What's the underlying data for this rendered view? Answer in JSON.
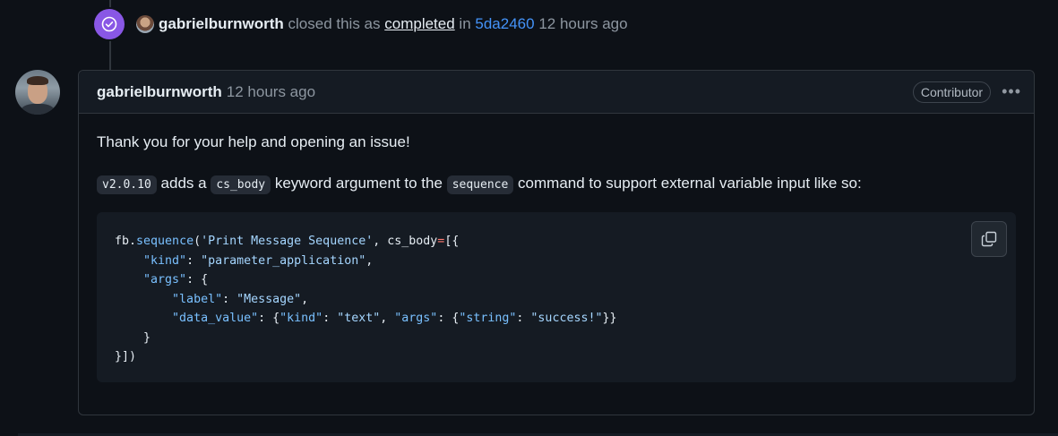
{
  "event": {
    "author": "gabrielburnworth",
    "action_text": "closed this as",
    "state_link": "completed",
    "in_text": "in",
    "commit": "5da2460",
    "time": "12 hours ago"
  },
  "comment": {
    "author": "gabrielburnworth",
    "time": "12 hours ago",
    "role_badge": "Contributor",
    "menu_icon": "kebab-horizontal-icon",
    "paragraph1": "Thank you for your help and opening an issue!",
    "paragraph2": {
      "version": "v2.0.10",
      "text1": "adds a",
      "arg": "cs_body",
      "text2": "keyword argument to the",
      "cmd": "sequence",
      "text3": "command to support external variable input like so:"
    },
    "code": {
      "line1": {
        "obj": "fb.",
        "fn": "sequence",
        "p1": "(",
        "s1": "'Print Message Sequence'",
        "p2": ", cs_body",
        "op": "=",
        "p3": "[{"
      },
      "line2": {
        "indent": "    ",
        "k": "\"kind\"",
        "sep": ": ",
        "v": "\"parameter_application\"",
        "end": ","
      },
      "line3": {
        "indent": "    ",
        "k": "\"args\"",
        "sep": ": {"
      },
      "line4": {
        "indent": "        ",
        "k": "\"label\"",
        "sep": ": ",
        "v": "\"Message\"",
        "end": ","
      },
      "line5": {
        "indent": "        ",
        "k": "\"data_value\"",
        "sep": ": {",
        "k2": "\"kind\"",
        "sep2": ": ",
        "v2": "\"text\"",
        "sep3": ", ",
        "k3": "\"args\"",
        "sep4": ": {",
        "k4": "\"string\"",
        "sep5": ": ",
        "v4": "\"success!\"",
        "end": "}}"
      },
      "line6": {
        "text": "    }"
      },
      "line7": {
        "text": "}])"
      },
      "copy_icon": "copy-icon"
    }
  },
  "colors": {
    "badge": "#8957e5",
    "link": "#4493f8",
    "background": "#0d1117"
  }
}
